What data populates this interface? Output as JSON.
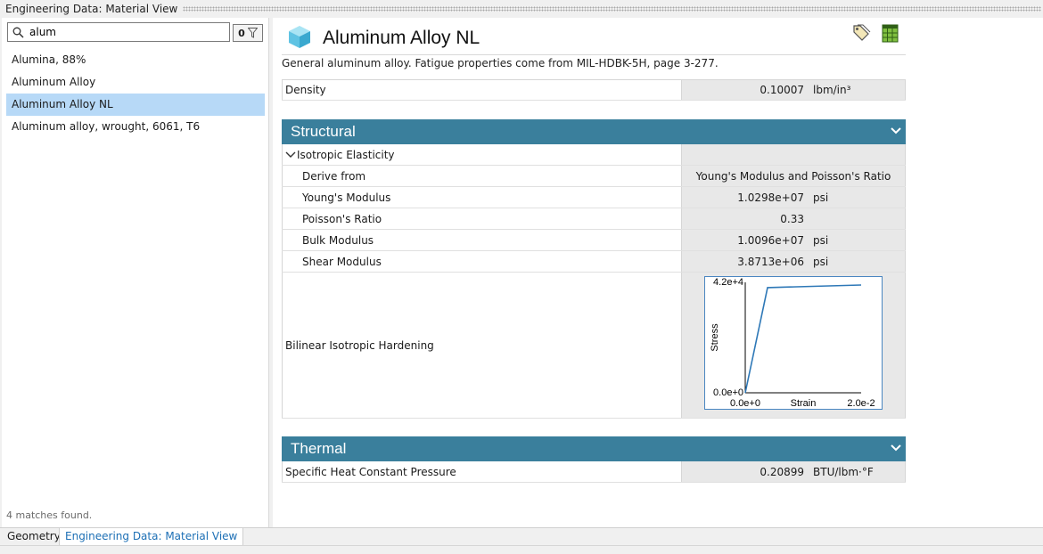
{
  "window": {
    "title": "Engineering Data: Material View"
  },
  "search": {
    "value": "alum",
    "filter_count": "0"
  },
  "materials": [
    {
      "label": "Alumina, 88%"
    },
    {
      "label": "Aluminum Alloy"
    },
    {
      "label": "Aluminum Alloy NL"
    },
    {
      "label": "Aluminum alloy, wrought, 6061, T6"
    }
  ],
  "match_status": "4 matches found.",
  "material": {
    "name": "Aluminum Alloy NL",
    "description": "General aluminum alloy. Fatigue properties come from MIL-HDBK-5H, page 3-277."
  },
  "density": {
    "label": "Density",
    "value": "0.10007",
    "unit": "lbm/in³"
  },
  "structural": {
    "title": "Structural",
    "group_label": "Isotropic Elasticity",
    "rows": [
      {
        "label": "Derive from",
        "value": "Young's Modulus and Poisson's Ratio",
        "unit": ""
      },
      {
        "label": "Young's Modulus",
        "value": "1.0298e+07",
        "unit": "psi"
      },
      {
        "label": "Poisson's Ratio",
        "value": "0.33",
        "unit": ""
      },
      {
        "label": "Bulk Modulus",
        "value": "1.0096e+07",
        "unit": "psi"
      },
      {
        "label": "Shear Modulus",
        "value": "3.8713e+06",
        "unit": "psi"
      }
    ],
    "hardening_label": "Bilinear Isotropic Hardening"
  },
  "chart_data": {
    "type": "line",
    "x": [
      0,
      0.00385,
      0.02
    ],
    "series": [
      {
        "values": [
          0,
          40000,
          41000
        ]
      }
    ],
    "xlabel": "Strain",
    "ylabel": "Stress",
    "xlim": [
      0,
      0.02
    ],
    "ylim": [
      0,
      42000
    ],
    "x_tick_labels": [
      "0.0e+0",
      "2.0e-2"
    ],
    "y_tick_labels": [
      "0.0e+0",
      "4.2e+4"
    ],
    "line_color": "#2e78b7",
    "grid": false
  },
  "thermal": {
    "title": "Thermal",
    "rows": [
      {
        "label": "Specific Heat Constant Pressure",
        "value": "0.20899",
        "unit": "BTU/lbm·°F"
      }
    ]
  },
  "tabs": [
    {
      "label": "Geometry"
    },
    {
      "label": "Engineering Data: Material View"
    }
  ],
  "colors": {
    "section_bar": "#3a7f9c",
    "selection": "#b7d9f7",
    "active_tab_text": "#1c6fb5"
  }
}
